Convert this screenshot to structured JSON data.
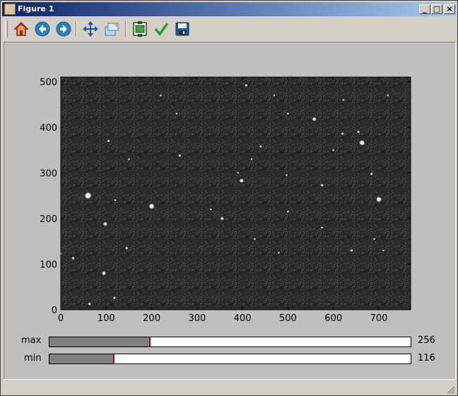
{
  "window": {
    "title": "Figure 1"
  },
  "toolbar": {
    "buttons": [
      {
        "id": "home",
        "icon": "home-icon"
      },
      {
        "id": "back",
        "icon": "back-arrow-icon"
      },
      {
        "id": "forward",
        "icon": "forward-arrow-icon"
      },
      {
        "id": "pan",
        "icon": "move-arrows-icon"
      },
      {
        "id": "zoom",
        "icon": "zoom-rect-icon"
      },
      {
        "id": "subplots",
        "icon": "subplots-config-icon"
      },
      {
        "id": "edit",
        "icon": "checkmark-icon"
      },
      {
        "id": "save",
        "icon": "floppy-disk-icon"
      }
    ]
  },
  "plot": {
    "x_ticks": [
      "0",
      "100",
      "200",
      "300",
      "400",
      "500",
      "600",
      "700"
    ],
    "y_ticks": [
      "0",
      "100",
      "200",
      "300",
      "400",
      "500"
    ],
    "xlim": [
      0,
      770
    ],
    "ylim": [
      0,
      510
    ],
    "background_color": "#2a2a2a",
    "stars": [
      [
        60,
        250,
        5
      ],
      [
        200,
        227,
        4
      ],
      [
        663,
        366,
        4
      ],
      [
        700,
        242,
        4
      ],
      [
        398,
        283,
        3
      ],
      [
        558,
        418,
        3
      ],
      [
        98,
        188,
        3
      ],
      [
        95,
        80,
        3
      ],
      [
        355,
        200,
        2.5
      ],
      [
        262,
        338,
        2
      ],
      [
        440,
        358,
        2
      ],
      [
        575,
        273,
        2
      ],
      [
        640,
        130,
        2
      ],
      [
        684,
        298,
        2
      ],
      [
        655,
        390,
        2
      ],
      [
        620,
        386,
        2
      ],
      [
        145,
        135,
        2
      ],
      [
        118,
        26,
        2
      ],
      [
        63,
        13,
        2
      ],
      [
        27,
        113,
        2
      ],
      [
        0,
        123,
        2
      ],
      [
        105,
        370,
        2
      ],
      [
        408,
        492,
        2
      ],
      [
        470,
        470,
        1.5
      ],
      [
        622,
        460,
        1.5
      ],
      [
        720,
        470,
        1.5
      ],
      [
        500,
        215,
        1.5
      ],
      [
        497,
        295,
        1.5
      ],
      [
        420,
        330,
        1.5
      ],
      [
        427,
        155,
        1.5
      ],
      [
        480,
        125,
        1.5
      ],
      [
        500,
        430,
        1.5
      ],
      [
        710,
        130,
        1.5
      ],
      [
        690,
        155,
        1.5
      ],
      [
        120,
        240,
        1.5
      ],
      [
        150,
        330,
        1.5
      ],
      [
        220,
        470,
        1.5
      ],
      [
        330,
        220,
        1.5
      ],
      [
        255,
        430,
        1.5
      ],
      [
        600,
        350,
        1.5
      ],
      [
        575,
        180,
        1.5
      ],
      [
        390,
        300,
        1.5
      ]
    ]
  },
  "sliders": {
    "max": {
      "label": "max",
      "value": "256",
      "fraction": 0.28
    },
    "min": {
      "label": "min",
      "value": "116",
      "fraction": 0.18
    }
  }
}
